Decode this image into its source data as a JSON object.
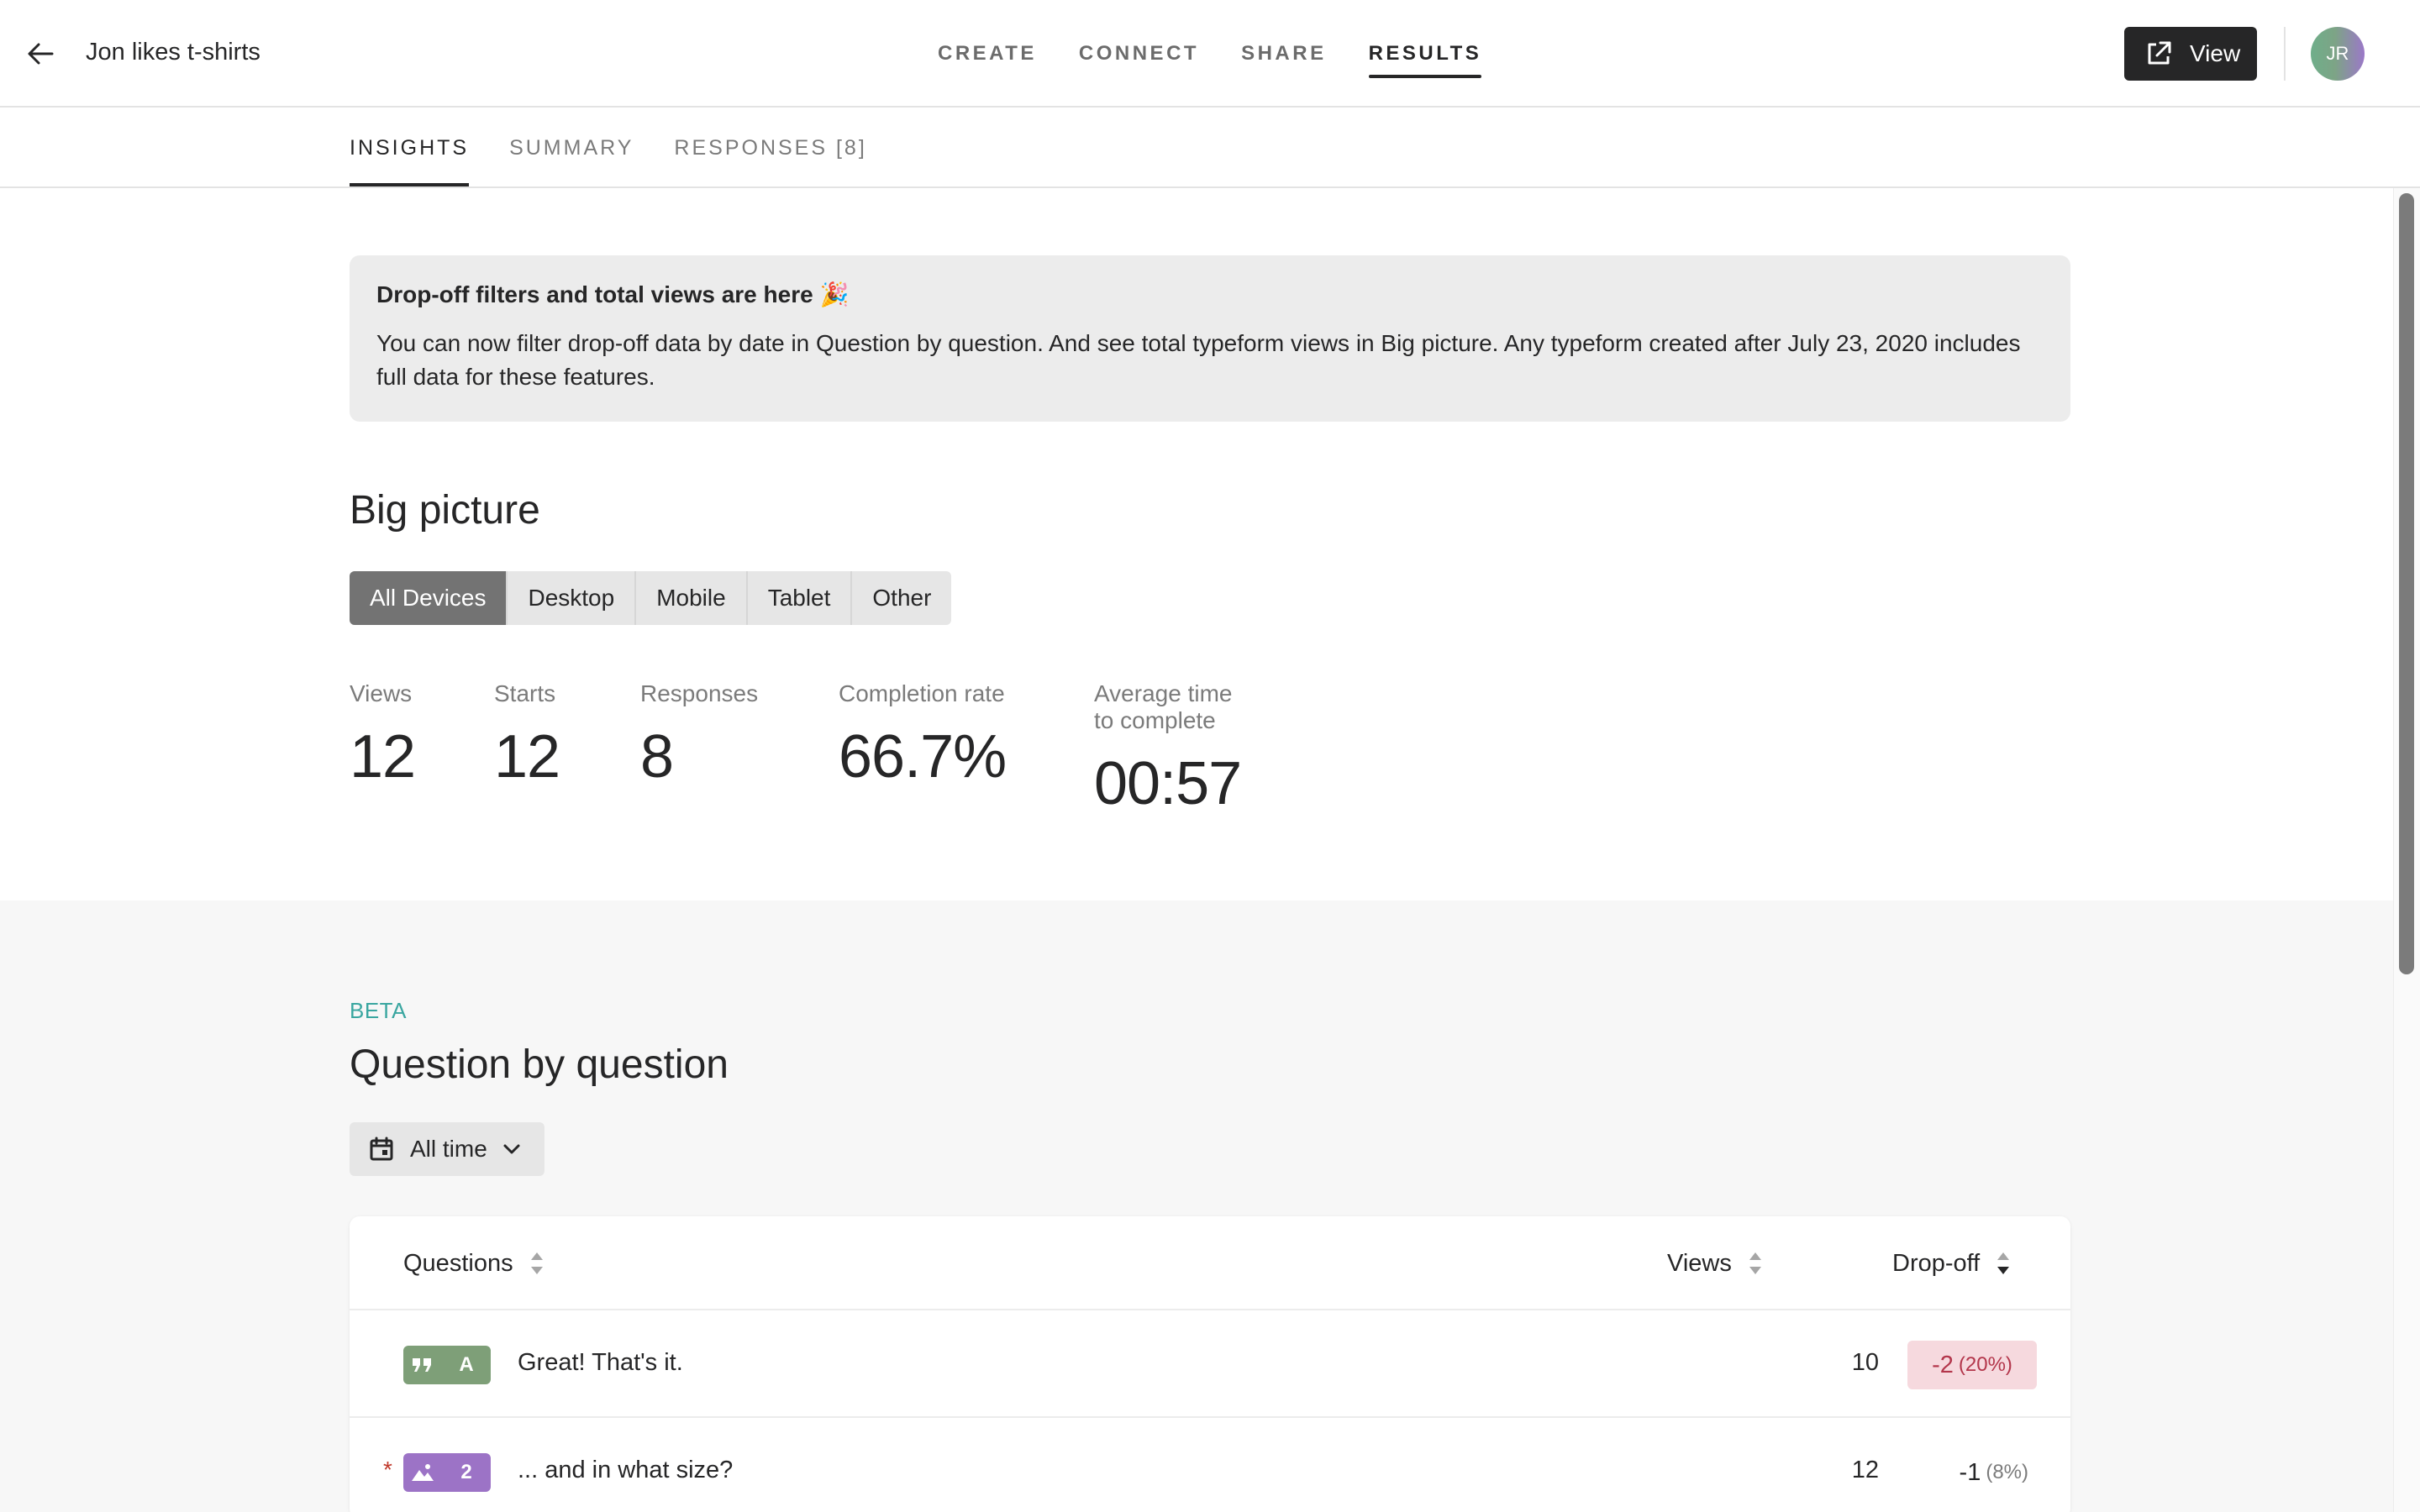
{
  "header": {
    "form_title": "Jon likes t-shirts",
    "nav_tabs": [
      {
        "label": "CREATE",
        "active": false
      },
      {
        "label": "CONNECT",
        "active": false
      },
      {
        "label": "SHARE",
        "active": false
      },
      {
        "label": "RESULTS",
        "active": true
      }
    ],
    "view_button": "View",
    "avatar_initials": "JR"
  },
  "subtabs": [
    {
      "label": "INSIGHTS",
      "active": true
    },
    {
      "label": "SUMMARY",
      "active": false
    },
    {
      "label": "RESPONSES [8]",
      "active": false
    }
  ],
  "notice": {
    "title": "Drop-off filters and total views are here",
    "title_emoji": "🎉",
    "body": "You can now filter drop-off data by date in Question by question. And see total typeform views in Big picture. Any typeform created after July 23, 2020 includes full data for these features."
  },
  "big_picture": {
    "heading": "Big picture",
    "device_filters": [
      {
        "label": "All Devices",
        "active": true
      },
      {
        "label": "Desktop",
        "active": false
      },
      {
        "label": "Mobile",
        "active": false
      },
      {
        "label": "Tablet",
        "active": false
      },
      {
        "label": "Other",
        "active": false
      }
    ],
    "stats": [
      {
        "label": "Views",
        "value": "12"
      },
      {
        "label": "Starts",
        "value": "12"
      },
      {
        "label": "Responses",
        "value": "8"
      },
      {
        "label": "Completion rate",
        "value": "66.7%"
      },
      {
        "label": "Average time to complete",
        "value": "00:57"
      }
    ]
  },
  "question_by_question": {
    "beta_label": "BETA",
    "heading": "Question by question",
    "time_filter": "All time",
    "columns": {
      "questions": "Questions",
      "views": "Views",
      "dropoff": "Drop-off"
    },
    "rows": [
      {
        "badge_icon": "quote-icon",
        "badge_label": "A",
        "badge_color": "#7e9f78",
        "required": false,
        "question": "Great! That's it.",
        "views": "10",
        "dropoff": "-2",
        "dropoff_pct": "(20%)",
        "highlight": true
      },
      {
        "badge_icon": "picture-choice-icon",
        "badge_label": "2",
        "badge_color": "#9c73c6",
        "required": true,
        "required_mark": "*",
        "question": "... and in what size?",
        "views": "12",
        "dropoff": "-1",
        "dropoff_pct": "(8%)",
        "highlight": false
      }
    ]
  },
  "colors": {
    "accent_dark": "#262627",
    "beta_teal": "#3aa6a0",
    "dropoff_highlight_bg": "#f6d9de",
    "dropoff_highlight_text": "#b3364b"
  }
}
